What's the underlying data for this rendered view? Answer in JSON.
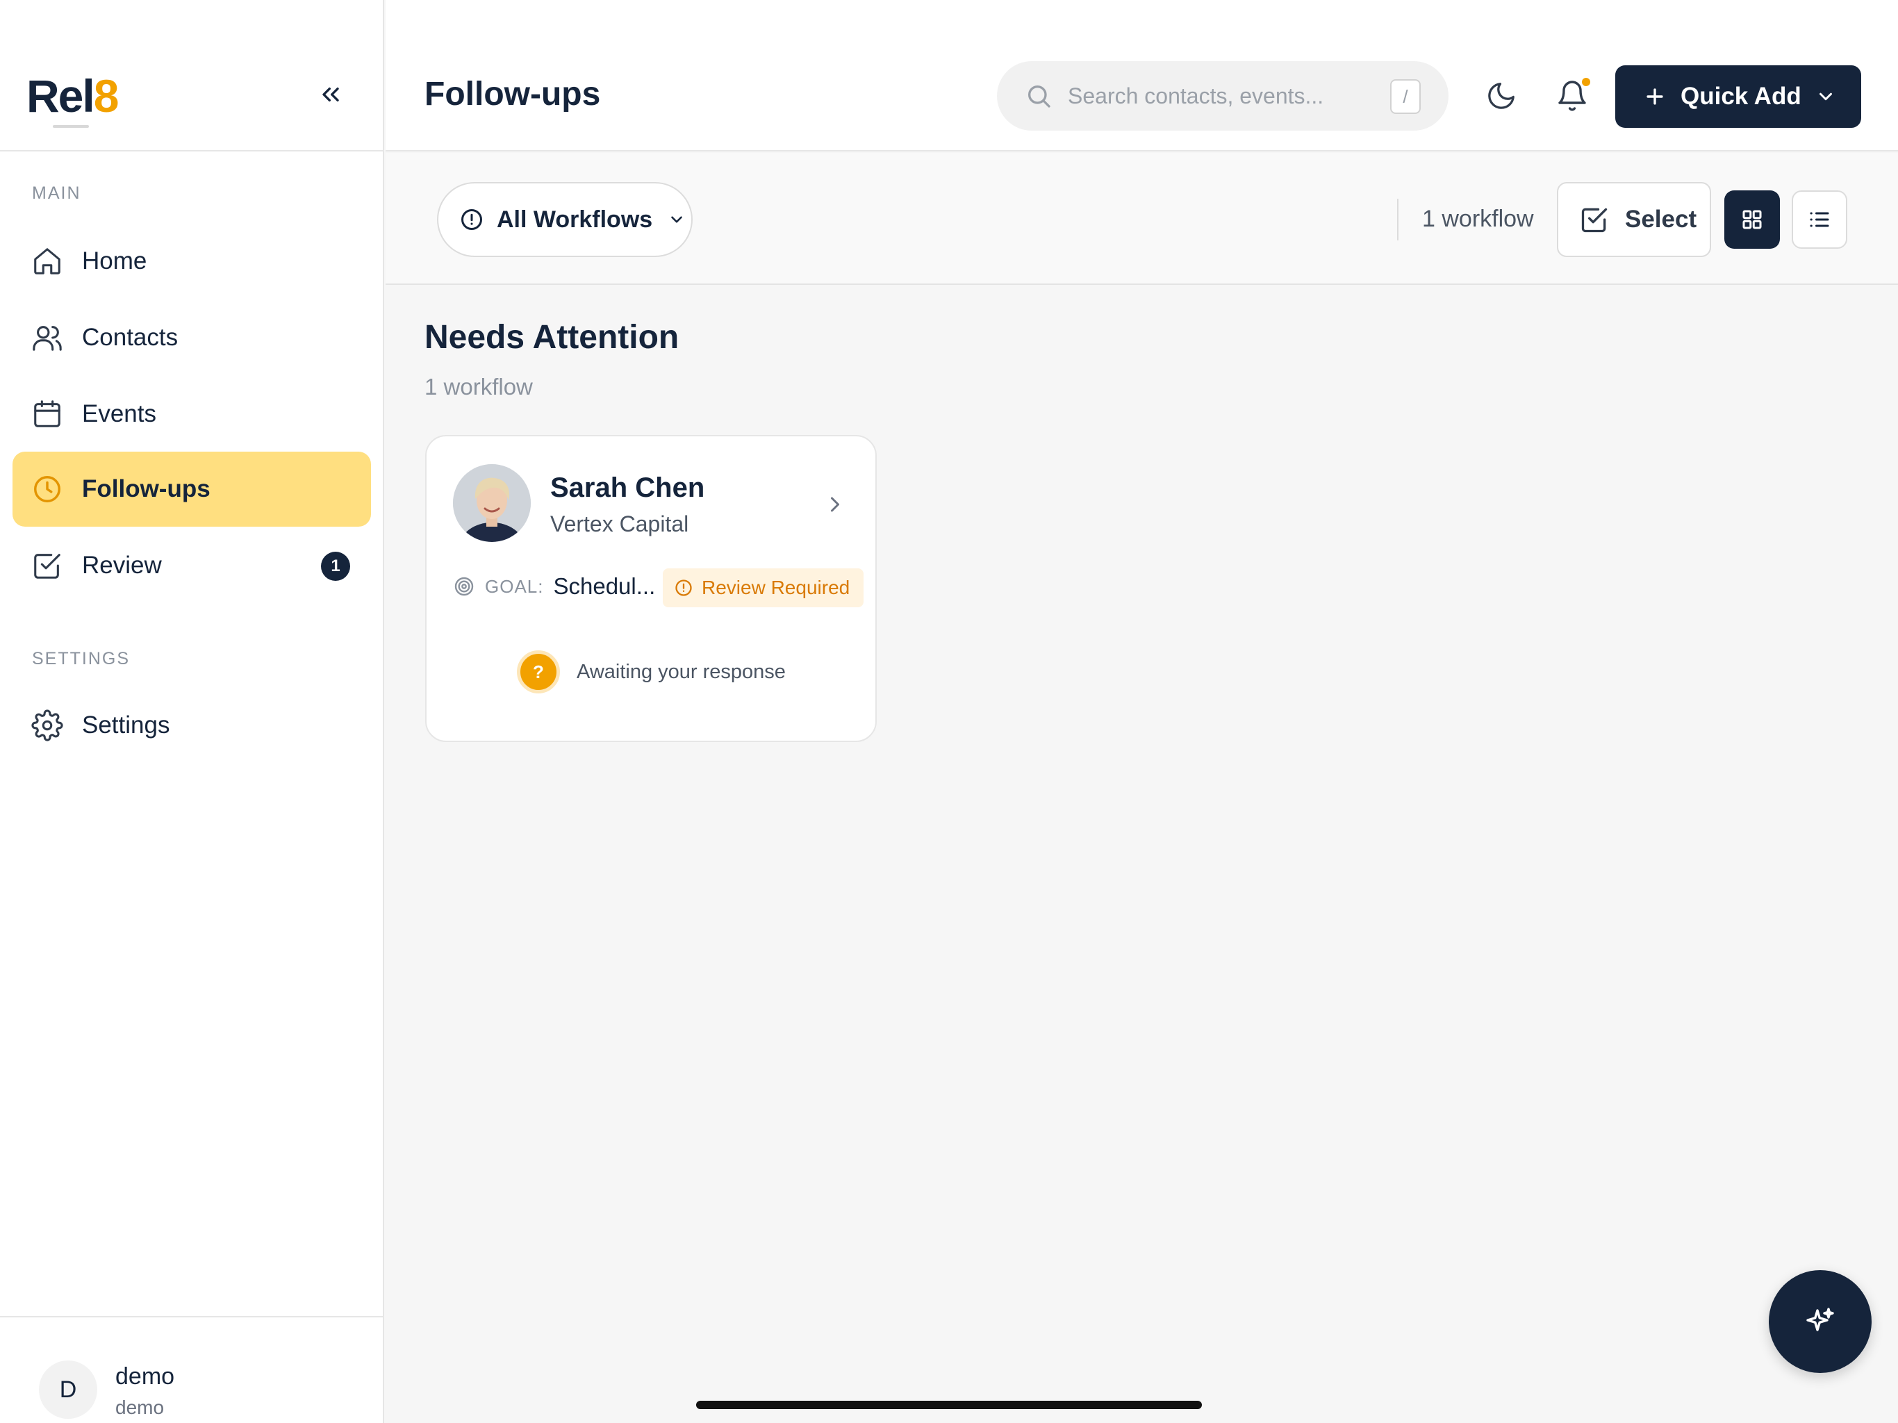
{
  "app": {
    "brand_main": "Rel",
    "brand_accent": "8",
    "accent_color": "#f2a100",
    "primary_color": "#15243b"
  },
  "sidebar": {
    "sections": [
      {
        "label": "MAIN",
        "items": [
          {
            "label": "Home",
            "icon": "home-icon"
          },
          {
            "label": "Contacts",
            "icon": "users-icon"
          },
          {
            "label": "Events",
            "icon": "calendar-icon"
          },
          {
            "label": "Follow-ups",
            "icon": "clock-icon",
            "active": true
          },
          {
            "label": "Review",
            "icon": "check-square-icon",
            "badge": "1"
          }
        ]
      },
      {
        "label": "SETTINGS",
        "items": [
          {
            "label": "Settings",
            "icon": "gear-icon"
          }
        ]
      }
    ],
    "user": {
      "initial": "D",
      "name": "demo",
      "sub": "demo"
    }
  },
  "header": {
    "title": "Follow-ups",
    "search_placeholder": "Search contacts, events...",
    "search_shortcut": "/",
    "quick_add_label": "Quick Add"
  },
  "toolbar": {
    "filter_label": "All Workflows",
    "count_text": "1 workflow",
    "select_label": "Select",
    "view_mode": "grid"
  },
  "content": {
    "section_title": "Needs Attention",
    "section_count": "1 workflow",
    "cards": [
      {
        "name": "Sarah Chen",
        "company": "Vertex Capital",
        "goal_label": "GOAL:",
        "goal_value": "Schedul...",
        "badge": "Review Required",
        "status_icon": "?",
        "status_text": "Awaiting your response"
      }
    ]
  }
}
